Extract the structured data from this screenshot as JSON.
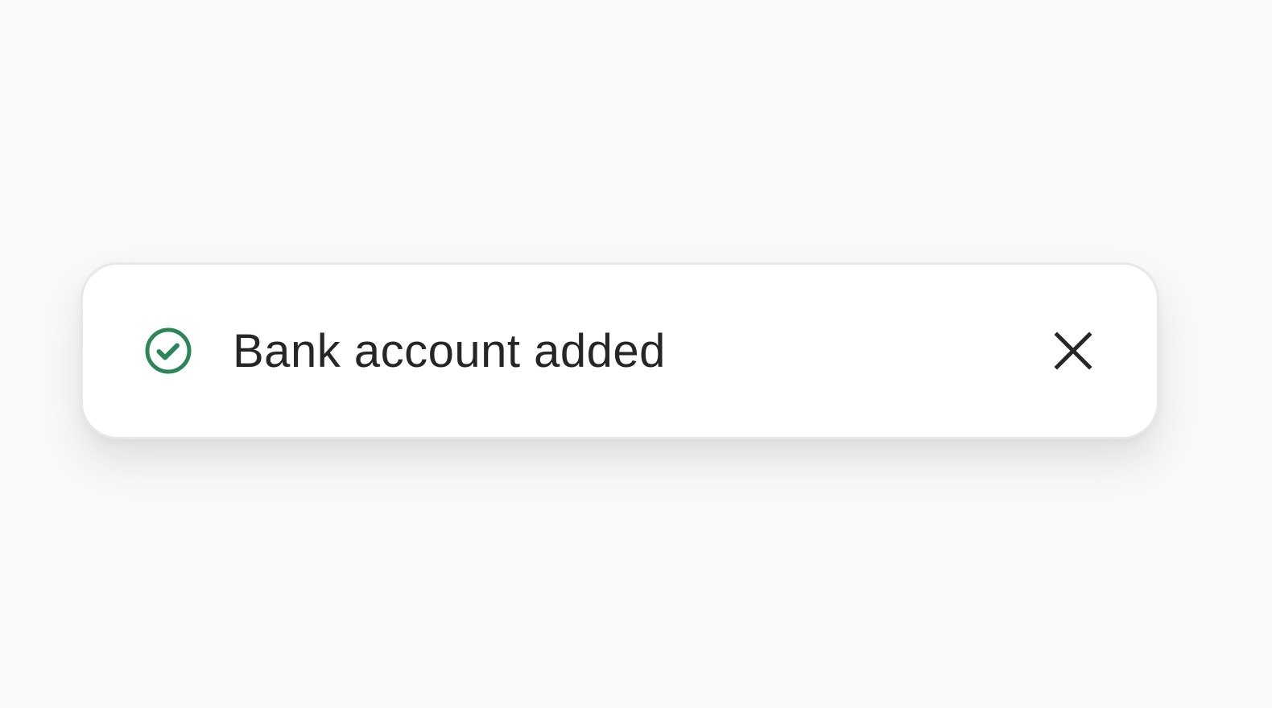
{
  "toast": {
    "message": "Bank account added",
    "status": "success",
    "status_icon": "check-circle-icon",
    "close_icon": "close-icon",
    "colors": {
      "success": "#2e8557",
      "text": "#262626",
      "close": "#262626",
      "background": "#ffffff",
      "page_background": "#f9f9f9"
    }
  }
}
